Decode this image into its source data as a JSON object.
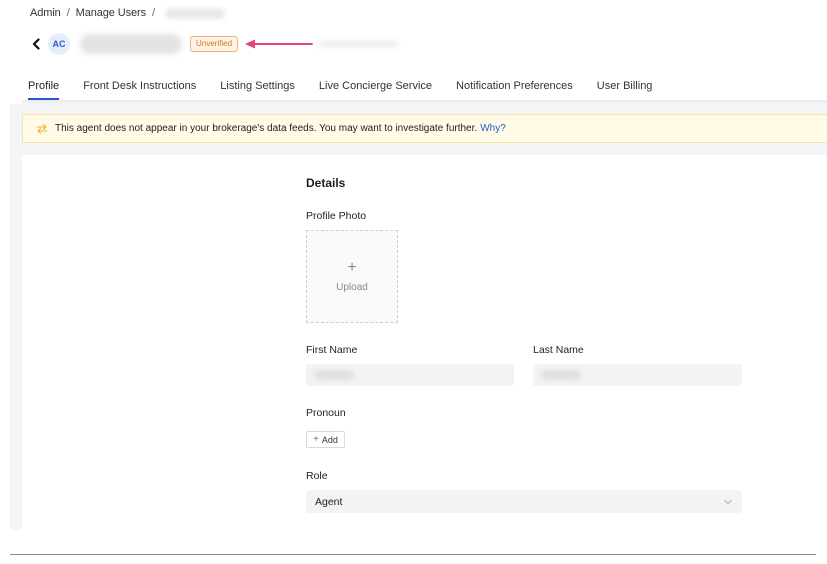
{
  "breadcrumb": {
    "items": [
      "Admin",
      "Manage Users"
    ],
    "separator": "/"
  },
  "header": {
    "avatar_initials": "AC",
    "status_badge": "Unverified"
  },
  "tabs": [
    {
      "label": "Profile",
      "active": true
    },
    {
      "label": "Front Desk Instructions",
      "active": false
    },
    {
      "label": "Listing Settings",
      "active": false
    },
    {
      "label": "Live Concierge Service",
      "active": false
    },
    {
      "label": "Notification Preferences",
      "active": false
    },
    {
      "label": "User Billing",
      "active": false
    }
  ],
  "alert": {
    "message": "This agent does not appear in your brokerage's data feeds. You may want to investigate further.",
    "link": "Why?"
  },
  "details": {
    "title": "Details",
    "profile_photo_label": "Profile Photo",
    "upload_label": "Upload",
    "first_name_label": "First Name",
    "last_name_label": "Last Name",
    "pronoun_label": "Pronoun",
    "add_label": "Add",
    "role_label": "Role",
    "role_value": "Agent"
  },
  "icons": {
    "back": "chevron-left-icon",
    "alert": "swap-arrows-icon",
    "upload": "plus-icon",
    "select": "chevron-down-icon"
  },
  "colors": {
    "accent": "#2b57c9",
    "badge_text": "#d4761c",
    "badge_border": "#f0b27a",
    "alert_bg": "#fffbe6",
    "annotation_arrow": "#e0457b"
  }
}
